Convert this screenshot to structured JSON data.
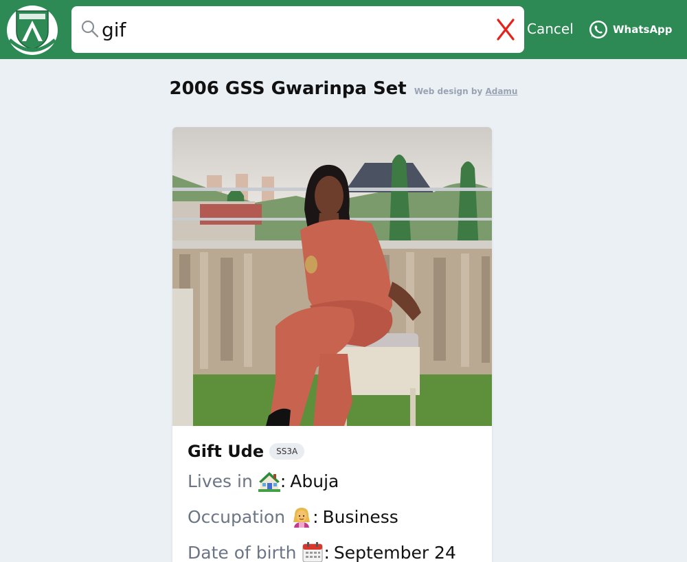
{
  "header": {
    "logo_text_top": "GOVT SEC. SCH",
    "logo_text_mid": "GWARINPA, ABUJA",
    "logo_motto": "KNOWLEDGE LEADS TO SUCCESS",
    "search_value": "gif",
    "clear_label": "X",
    "cancel_label": "Cancel",
    "whatsapp_label": "WhatsApp",
    "brand_color": "#2d8a55"
  },
  "page": {
    "title": "2006 GSS Gwarinpa Set",
    "credit_prefix": "Web design by",
    "credit_author": "Adamu"
  },
  "card": {
    "name": "Gift Ude",
    "class_badge": "SS3A",
    "rows": [
      {
        "label": "Lives in",
        "icon": "house-icon",
        "value": "Abuja"
      },
      {
        "label": "Occupation",
        "icon": "person-icon",
        "value": "Business"
      },
      {
        "label": "Date of birth",
        "icon": "calendar-icon",
        "value": "September 24"
      }
    ]
  }
}
